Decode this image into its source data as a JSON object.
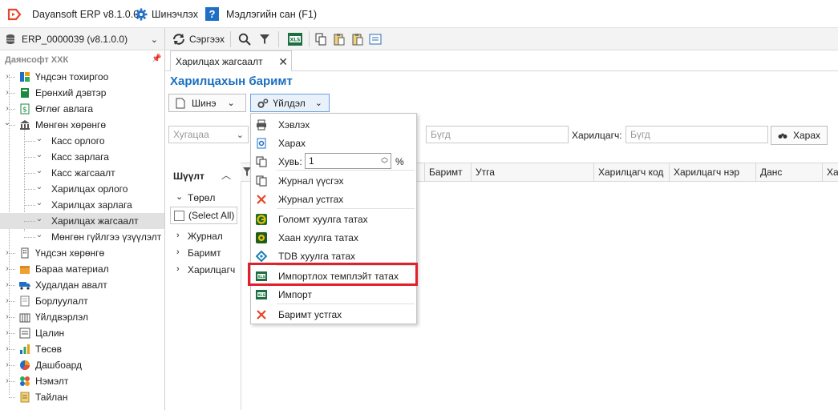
{
  "app": {
    "title": "Dayansoft ERP v8.1.0.0",
    "settings_label": "Шинэчлэх",
    "help_label": "Мэдлэгийн сан (F1)"
  },
  "toolbar": {
    "database": "ERP_0000039 (v8.1.0.0)",
    "refresh_label": "Сэргээх"
  },
  "sidebar": {
    "company": "Даянсофт ХХК",
    "items": [
      {
        "label": "Үндсэн тохиргоо",
        "icon": "grid-icon",
        "expander": "›"
      },
      {
        "label": "Ерөнхий дэвтэр",
        "icon": "book-icon",
        "expander": "›"
      },
      {
        "label": "Өглөг авлага",
        "icon": "money-icon",
        "expander": "›"
      },
      {
        "label": "Мөнгөн хөрөнгө",
        "icon": "bank-icon",
        "expander": "⌄"
      },
      {
        "label": "Касс орлого",
        "expander": "⌄"
      },
      {
        "label": "Касс зарлага",
        "expander": "⌄"
      },
      {
        "label": "Касс жагсаалт",
        "expander": "⌄"
      },
      {
        "label": "Харилцах орлого",
        "expander": "⌄"
      },
      {
        "label": "Харилцах зарлага",
        "expander": "⌄"
      },
      {
        "label": "Харилцах жагсаалт",
        "expander": "⌄"
      },
      {
        "label": "Мөнгөн гүйлгээ үзүүлэлт",
        "expander": "⌄"
      },
      {
        "label": "Үндсэн хөрөнгө",
        "icon": "building-icon",
        "expander": "›"
      },
      {
        "label": "Бараа материал",
        "icon": "box-icon",
        "expander": "›"
      },
      {
        "label": "Худалдан авалт",
        "icon": "truck-icon",
        "expander": "›"
      },
      {
        "label": "Борлуулалт",
        "icon": "document-icon",
        "expander": "›"
      },
      {
        "label": "Үйлдвэрлэл",
        "icon": "factory-icon",
        "expander": "›"
      },
      {
        "label": "Цалин",
        "icon": "payroll-icon",
        "expander": "›"
      },
      {
        "label": "Төсөв",
        "icon": "chart-icon",
        "expander": "›"
      },
      {
        "label": "Дашбоард",
        "icon": "pie-icon",
        "expander": "›"
      },
      {
        "label": "Нэмэлт",
        "icon": "puzzle-icon",
        "expander": "›"
      },
      {
        "label": "Тайлан",
        "icon": "report-icon",
        "expander": ""
      }
    ]
  },
  "main": {
    "tab_label": "Харилцах жагсаалт",
    "page_title": "Харилцахын баримт",
    "new_button": "Шинэ",
    "action_button": "Үйлдэл",
    "period_placeholder": "Хугацаа",
    "all_placeholder": "Бүгд",
    "counterparty_label": "Харилцагч:",
    "counterparty_placeholder": "Бүгд",
    "search_button": "Харах"
  },
  "filter": {
    "title": "Шүүлт",
    "type_label": "Төрөл",
    "select_all": "(Select All)",
    "items": [
      "Журнал",
      "Баримт",
      "Харилцагч"
    ]
  },
  "grid": {
    "columns": [
      "Баримт",
      "Утга",
      "Харилцагч код",
      "Харилцагч нэр",
      "Данс",
      "Ха"
    ]
  },
  "menu": {
    "items": [
      {
        "label": "Хэвлэх",
        "icon": "printer-icon"
      },
      {
        "label": "Харах",
        "icon": "preview-icon"
      },
      {
        "label": "Хувь:",
        "icon": "copy-icon",
        "value": "1",
        "unit": "%"
      },
      {
        "label": "Журнал үүсгэх",
        "icon": "journal-icon"
      },
      {
        "label": "Журнал устгах",
        "icon": "delete-icon"
      },
      {
        "label": "Голомт хуулга татах",
        "icon": "golomt-icon"
      },
      {
        "label": "Хаан хуулга татах",
        "icon": "khan-icon"
      },
      {
        "label": "TDB хуулга татах",
        "icon": "tdb-icon"
      },
      {
        "label": "Импортлох темплэйт татах",
        "icon": "excel-icon"
      },
      {
        "label": "Импорт",
        "icon": "excel-icon"
      },
      {
        "label": "Баримт устгах",
        "icon": "delete-icon"
      }
    ]
  },
  "colors": {
    "accent": "#1b6fbf",
    "highlight": "#e0202b"
  }
}
